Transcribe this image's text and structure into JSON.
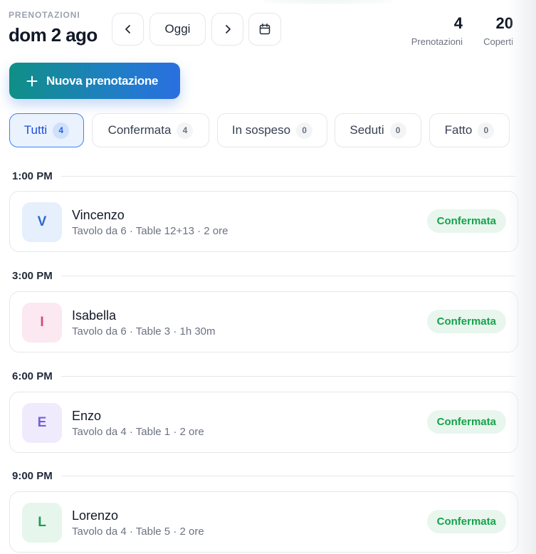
{
  "header": {
    "eyebrow": "PRENOTAZIONI",
    "date": "dom 2 ago",
    "today_label": "Oggi",
    "icons": {
      "prev": "chevron-left-icon",
      "next": "chevron-right-icon",
      "calendar": "calendar-icon"
    }
  },
  "stats": {
    "bookings": {
      "value": "4",
      "label": "Prenotazioni"
    },
    "covers": {
      "value": "20",
      "label": "Coperti"
    }
  },
  "new_booking": {
    "label": "Nuova prenotazione",
    "icon": "plus-icon"
  },
  "filters": [
    {
      "label": "Tutti",
      "count": "4",
      "active": true
    },
    {
      "label": "Confermata",
      "count": "4",
      "active": false
    },
    {
      "label": "In sospeso",
      "count": "0",
      "active": false
    },
    {
      "label": "Seduti",
      "count": "0",
      "active": false
    },
    {
      "label": "Fatto",
      "count": "0",
      "active": false
    }
  ],
  "slots": [
    {
      "time": "1:00 PM",
      "booking": {
        "initial": "V",
        "name": "Vincenzo",
        "details": "Tavolo da 6 · Table 12+13 · 2 ore",
        "status": "Confermata",
        "avatar_bg": "#e6effc",
        "avatar_fg": "#2f66d0"
      }
    },
    {
      "time": "3:00 PM",
      "booking": {
        "initial": "I",
        "name": "Isabella",
        "details": "Tavolo da 6 · Table 3 · 1h 30m",
        "status": "Confermata",
        "avatar_bg": "#fce8f0",
        "avatar_fg": "#d6457f"
      }
    },
    {
      "time": "6:00 PM",
      "booking": {
        "initial": "E",
        "name": "Enzo",
        "details": "Tavolo da 4 · Table 1 · 2 ore",
        "status": "Confermata",
        "avatar_bg": "#efebfd",
        "avatar_fg": "#7c5ce0"
      }
    },
    {
      "time": "9:00 PM",
      "booking": {
        "initial": "L",
        "name": "Lorenzo",
        "details": "Tavolo da 4 · Table 5 · 2 ore",
        "status": "Confermata",
        "avatar_bg": "#e6f6ec",
        "avatar_fg": "#1f9a52"
      }
    }
  ],
  "colors": {
    "accent_gradient_start": "#0f8f86",
    "accent_gradient_end": "#2a6fe0",
    "status_confirmed_bg": "#e8f6ee",
    "status_confirmed_fg": "#16a34a"
  }
}
